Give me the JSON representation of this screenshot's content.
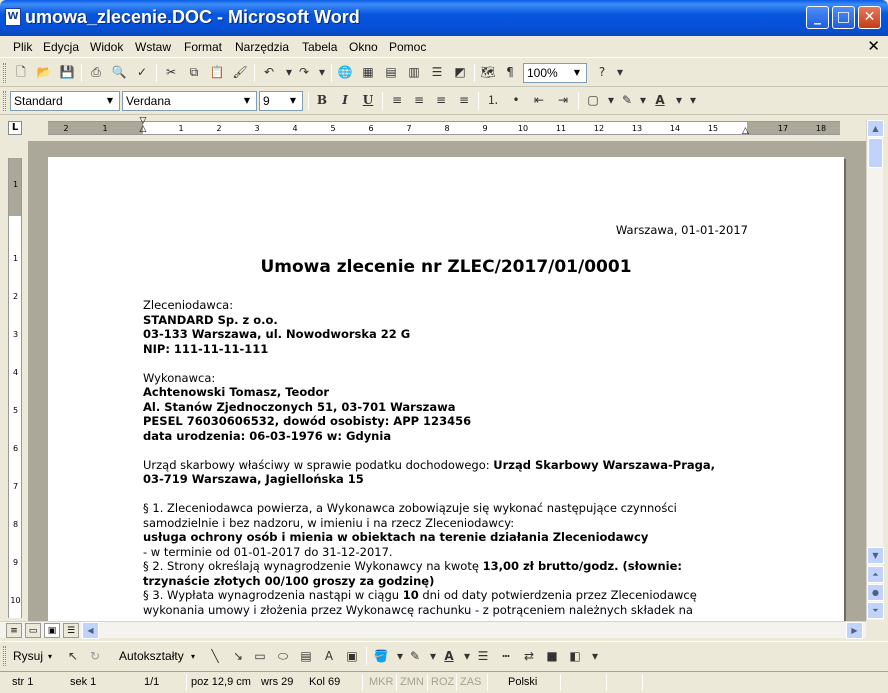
{
  "window": {
    "title": "umowa_zlecenie.DOC - Microsoft Word",
    "app_icon": "word-doc-icon",
    "buttons": [
      "minimize",
      "maximize",
      "close"
    ]
  },
  "menu": {
    "items": [
      "Plik",
      "Edycja",
      "Widok",
      "Wstaw",
      "Format",
      "Narzędzia",
      "Tabela",
      "Okno",
      "Pomoc"
    ]
  },
  "standard_toolbar": {
    "zoom": "100%",
    "icons": [
      "new-icon",
      "open-icon",
      "save-icon",
      "print-icon",
      "print-preview-icon",
      "spelling-icon",
      "cut-icon",
      "copy-icon",
      "paste-icon",
      "format-painter-icon",
      "undo-icon",
      "redo-icon",
      "hyperlink-icon",
      "tables-borders-icon",
      "insert-table-icon",
      "insert-excel-icon",
      "columns-icon",
      "drawing-icon",
      "document-map-icon",
      "show-formatting-icon",
      "help-icon"
    ]
  },
  "formatting_toolbar": {
    "style": "Standard",
    "font": "Verdana",
    "size": "9",
    "bold": "B",
    "italic": "I",
    "underline": "U"
  },
  "ruler": {
    "h_labels": [
      "2",
      "1",
      "1",
      "2",
      "3",
      "4",
      "5",
      "6",
      "7",
      "8",
      "9",
      "10",
      "11",
      "12",
      "13",
      "14",
      "15",
      "17",
      "18"
    ],
    "v_labels": [
      "1",
      "1",
      "2",
      "3",
      "4",
      "5",
      "6",
      "7",
      "8",
      "9",
      "10"
    ]
  },
  "document": {
    "date": "Warszawa, 01-01-2017",
    "title": "Umowa zlecenie nr ZLEC/2017/01/0001",
    "lines": [
      {
        "t": "Zleceniodawca:",
        "b": false
      },
      {
        "t": "STANDARD Sp. z o.o.",
        "b": true
      },
      {
        "t": "03-133 Warszawa, ul. Nowodworska 22 G",
        "b": true
      },
      {
        "t": "NIP: 111-11-11-111",
        "b": true
      },
      {
        "t": "",
        "b": false
      },
      {
        "t": "Wykonawca:",
        "b": false
      },
      {
        "t": "Achtenowski Tomasz, Teodor",
        "b": true
      },
      {
        "t": "Al. Stanów Zjednoczonych 51, 03-701 Warszawa",
        "b": true
      },
      {
        "t": "PESEL 76030606532, dowód osobisty: APP 123456",
        "b": true
      },
      {
        "t": "data urodzenia: 06-03-1976 w: Gdynia",
        "b": true
      },
      {
        "t": "",
        "b": false
      },
      {
        "t": "Urząd skarbowy właściwy w sprawie podatku dochodowego: ",
        "b": false,
        "bold_tail": "Urząd Skarbowy Warszawa-Praga,"
      },
      {
        "t": "03-719 Warszawa, Jagiellońska 15",
        "b": true
      },
      {
        "t": "",
        "b": false
      },
      {
        "t": "§ 1. Zleceniodawca powierza, a Wykonawca zobowiązuje się wykonać następujące czynności",
        "b": false
      },
      {
        "t": "samodzielnie i bez nadzoru, w imieniu i na rzecz Zleceniodawcy:",
        "b": false
      },
      {
        "t": "usługa ochrony osób i mienia w obiektach na terenie działania Zleceniodawcy",
        "b": true
      },
      {
        "t": "- w terminie od 01-01-2017 do 31-12-2017.",
        "b": false
      },
      {
        "t": "§ 2. Strony określają wynagrodzenie Wykonawcy na kwotę ",
        "b": false,
        "bold_tail": "13,00 zł brutto/godz. (słownie:"
      },
      {
        "t": "trzynaście złotych 00/100 groszy za godzinę)",
        "b": true
      },
      {
        "t": "§ 3. Wypłata wynagrodzenia nastąpi w ciągu ",
        "b": false,
        "bold_mid": "10",
        "tail": " dni od daty potwierdzenia przez Zleceniodawcę"
      },
      {
        "t": "wykonania umowy i złożenia przez Wykonawcę rachunku - z potrąceniem należnych składek na",
        "b": false
      }
    ]
  },
  "drawing_toolbar": {
    "draw": "Rysuj",
    "autoshapes": "Autokształty"
  },
  "status": {
    "page": "str 1",
    "section": "sek 1",
    "pages": "1/1",
    "pos": "poz 12,9 cm",
    "line": "wrs 29",
    "col": "Kol 69",
    "rec": "MKR",
    "trk": "ZMN",
    "ext": "ROZ",
    "ovr": "ZAS",
    "lang": "Polski"
  }
}
